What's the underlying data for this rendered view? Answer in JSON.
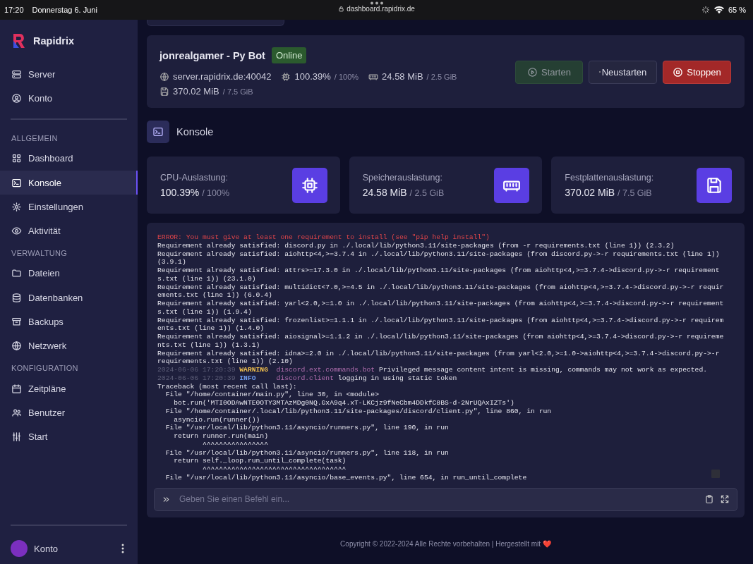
{
  "status_bar": {
    "time": "17:20",
    "date": "Donnerstag 6. Juni",
    "url": "dashboard.rapidrix.de",
    "battery": "65 %"
  },
  "sidebar": {
    "brand": "Rapidrix",
    "top_items": [
      {
        "label": "Server",
        "selected": false
      },
      {
        "label": "Konto",
        "selected": false
      }
    ],
    "sections": [
      {
        "title": "ALLGEMEIN",
        "items": [
          {
            "label": "Dashboard",
            "selected": false
          },
          {
            "label": "Konsole",
            "selected": true
          },
          {
            "label": "Einstellungen",
            "selected": false
          },
          {
            "label": "Aktivität",
            "selected": false
          }
        ]
      },
      {
        "title": "VERWALTUNG",
        "items": [
          {
            "label": "Dateien",
            "selected": false
          },
          {
            "label": "Datenbanken",
            "selected": false
          },
          {
            "label": "Backups",
            "selected": false
          },
          {
            "label": "Netzwerk",
            "selected": false
          }
        ]
      },
      {
        "title": "KONFIGURATION",
        "items": [
          {
            "label": "Zeitpläne",
            "selected": false
          },
          {
            "label": "Benutzer",
            "selected": false
          },
          {
            "label": "Start",
            "selected": false
          }
        ]
      }
    ],
    "account": {
      "label": "Konto"
    }
  },
  "server": {
    "name": "jonrealgamer - Py Bot",
    "status": "Online",
    "address": "server.rapidrix.de:40042",
    "stats": [
      {
        "value": "100.39%",
        "limit": "/ 100%"
      },
      {
        "value": "24.58 MiB",
        "limit": "/ 2.5 GiB"
      },
      {
        "value": "370.02 MiB",
        "limit": "/ 7.5 GiB"
      }
    ],
    "buttons": [
      {
        "label": "Starten",
        "kind": "start",
        "disabled": true
      },
      {
        "label": "Neustarten",
        "kind": "restart",
        "disabled": false
      },
      {
        "label": "Stoppen",
        "kind": "stop",
        "disabled": false
      }
    ]
  },
  "console_title": "Konsole",
  "stats": [
    {
      "label": "CPU-Auslastung:",
      "value": "100.39%",
      "limit": "/ 100%"
    },
    {
      "label": "Speicherauslastung:",
      "value": "24.58 MiB",
      "limit": "/ 2.5 GiB"
    },
    {
      "label": "Festplattenauslastung:",
      "value": "370.02 MiB",
      "limit": "/ 7.5 GiB"
    }
  ],
  "console": {
    "lines": [
      {
        "kind": "error",
        "text": "ERROR: You must give at least one requirement to install (see \"pip help install\")"
      },
      {
        "kind": "plain",
        "text": "Requirement already satisfied: discord.py in ./.local/lib/python3.11/site-packages (from -r requirements.txt (line 1)) (2.3.2)"
      },
      {
        "kind": "plain",
        "text": "Requirement already satisfied: aiohttp<4,>=3.7.4 in ./.local/lib/python3.11/site-packages (from discord.py->-r requirements.txt (line 1)) (3.9.1)"
      },
      {
        "kind": "plain",
        "text": "Requirement already satisfied: attrs>=17.3.0 in ./.local/lib/python3.11/site-packages (from aiohttp<4,>=3.7.4->discord.py->-r requirements.txt (line 1)) (23.1.0)"
      },
      {
        "kind": "plain",
        "text": "Requirement already satisfied: multidict<7.0,>=4.5 in ./.local/lib/python3.11/site-packages (from aiohttp<4,>=3.7.4->discord.py->-r requirements.txt (line 1)) (6.0.4)"
      },
      {
        "kind": "plain",
        "text": "Requirement already satisfied: yarl<2.0,>=1.0 in ./.local/lib/python3.11/site-packages (from aiohttp<4,>=3.7.4->discord.py->-r requirements.txt (line 1)) (1.9.4)"
      },
      {
        "kind": "plain",
        "text": "Requirement already satisfied: frozenlist>=1.1.1 in ./.local/lib/python3.11/site-packages (from aiohttp<4,>=3.7.4->discord.py->-r requirements.txt (line 1)) (1.4.0)"
      },
      {
        "kind": "plain",
        "text": "Requirement already satisfied: aiosignal>=1.1.2 in ./.local/lib/python3.11/site-packages (from aiohttp<4,>=3.7.4->discord.py->-r requirements.txt (line 1)) (1.3.1)"
      },
      {
        "kind": "plain",
        "text": "Requirement already satisfied: idna>=2.0 in ./.local/lib/python3.11/site-packages (from yarl<2.0,>=1.0->aiohttp<4,>=3.7.4->discord.py->-r requirements.txt (line 1)) (2.10)"
      },
      {
        "kind": "warning",
        "time": "2024-06-06 17:20:39",
        "level": "WARNING",
        "logger": "discord.ext.commands.bot",
        "text": "Privileged message content intent is missing, commands may not work as expected."
      },
      {
        "kind": "info",
        "time": "2024-06-06 17:20:39",
        "level": "INFO",
        "logger": "discord.client",
        "text": "logging in using static token"
      },
      {
        "kind": "plain",
        "text": "Traceback (most recent call last):"
      },
      {
        "kind": "plain",
        "text": "  File \"/home/container/main.py\", line 30, in <module>"
      },
      {
        "kind": "plain",
        "text": "    bot.run('MTI0ODAwNTE0OTY3MTAzMDg0NQ.GxA9q4.xT-LKCjz9fNeCbm4DDkfC8BS-d-2NrUQAxIZTs')"
      },
      {
        "kind": "plain",
        "text": "  File \"/home/container/.local/lib/python3.11/site-packages/discord/client.py\", line 860, in run"
      },
      {
        "kind": "plain",
        "text": "    asyncio.run(runner())"
      },
      {
        "kind": "plain",
        "text": "  File \"/usr/local/lib/python3.11/asyncio/runners.py\", line 190, in run"
      },
      {
        "kind": "plain",
        "text": "    return runner.run(main)"
      },
      {
        "kind": "plain",
        "text": "           ^^^^^^^^^^^^^^^^"
      },
      {
        "kind": "plain",
        "text": "  File \"/usr/local/lib/python3.11/asyncio/runners.py\", line 118, in run"
      },
      {
        "kind": "plain",
        "text": "    return self._loop.run_until_complete(task)"
      },
      {
        "kind": "plain",
        "text": "           ^^^^^^^^^^^^^^^^^^^^^^^^^^^^^^^^^^^"
      },
      {
        "kind": "plain",
        "text": "  File \"/usr/local/lib/python3.11/asyncio/base_events.py\", line 654, in run_until_complete"
      }
    ],
    "input": {
      "placeholder": "Geben Sie einen Befehl ein..."
    }
  },
  "footer": {
    "text": "Copyright © 2022-2024 Alle Rechte vorbehalten | Hergestellt mit",
    "heart": "❤️"
  }
}
